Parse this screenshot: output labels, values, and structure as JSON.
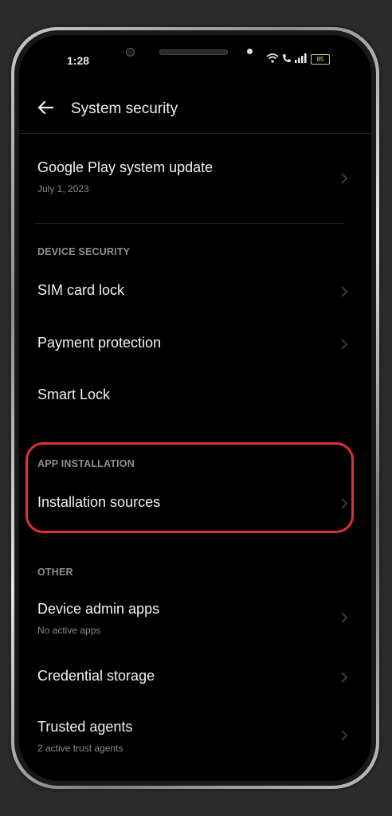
{
  "status_bar": {
    "time": "1:28",
    "battery": "85"
  },
  "app_bar": {
    "title": "System security"
  },
  "update_item": {
    "title": "Google Play system update",
    "subtitle": "July 1, 2023"
  },
  "device_security": {
    "header": "DEVICE SECURITY",
    "items": [
      {
        "title": "SIM card lock"
      },
      {
        "title": "Payment protection"
      },
      {
        "title": "Smart Lock"
      }
    ]
  },
  "app_installation": {
    "header": "APP INSTALLATION",
    "items": [
      {
        "title": "Installation sources"
      }
    ]
  },
  "other": {
    "header": "OTHER",
    "items": [
      {
        "title": "Device admin apps",
        "subtitle": "No active apps"
      },
      {
        "title": "Credential storage"
      },
      {
        "title": "Trusted agents",
        "subtitle": "2 active trust agents"
      }
    ]
  },
  "colors": {
    "highlight": "#e0303a",
    "background": "#000000",
    "text": "#f2f2f2"
  },
  "icons": [
    "back-arrow-icon",
    "chevron-right-icon",
    "wifi-icon",
    "call-icon",
    "signal-icon",
    "battery-icon"
  ]
}
